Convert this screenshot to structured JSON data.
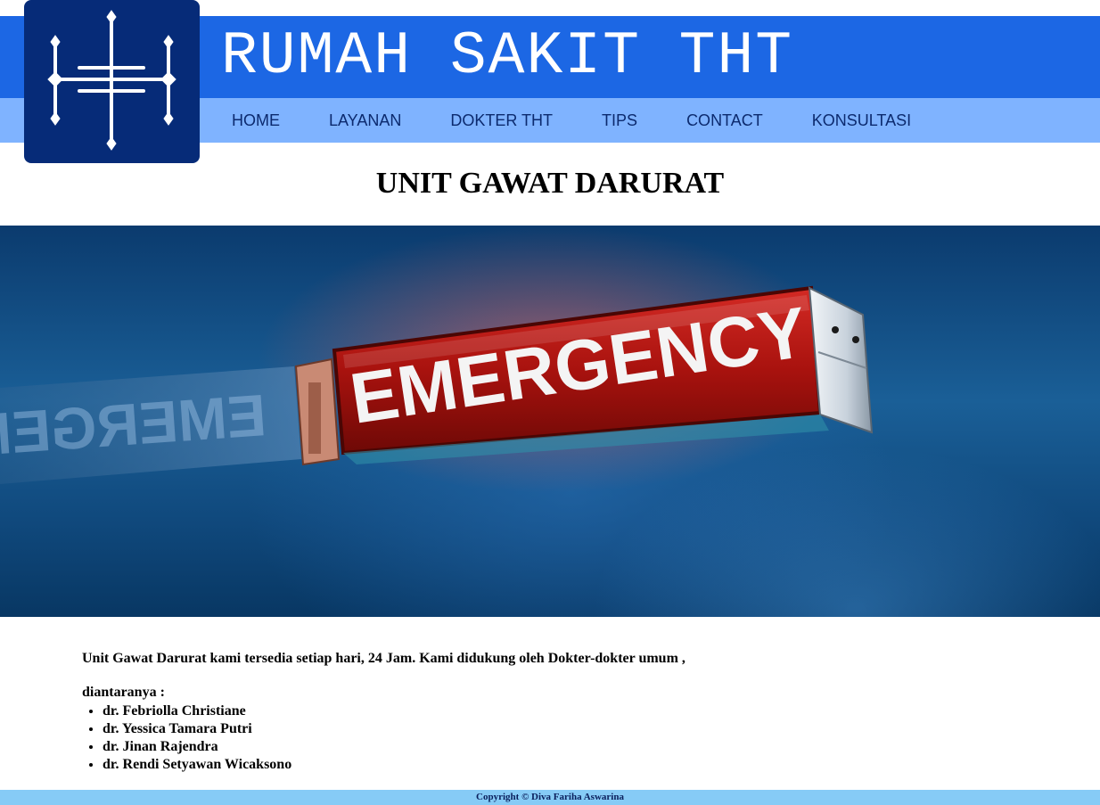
{
  "header": {
    "title": "RUMAH SAKIT THT",
    "nav": [
      "HOME",
      "LAYANAN",
      "DOKTER THT",
      "TIPS",
      "CONTACT",
      "KONSULTASI"
    ]
  },
  "main": {
    "heading": "UNIT GAWAT DARURAT",
    "banner": {
      "sign_text": "EMERGENCY",
      "reflection_text": "EMERGENCY"
    },
    "intro": "Unit Gawat Darurat kami tersedia setiap hari, 24 Jam. Kami didukung oleh Dokter-dokter umum ,",
    "list_label": "diantaranya :",
    "doctors": [
      "dr. Febriolla Christiane",
      "dr. Yessica Tamara Putri",
      "dr. Jinan Rajendra",
      "dr. Rendi Setyawan Wicaksono"
    ]
  },
  "footer": {
    "copyright": "Copyright © Diva Fariha Aswarina"
  },
  "colors": {
    "header_blue": "#1c67e4",
    "nav_bar": "#7fb3ff",
    "logo_bg": "#062b78",
    "footer_bar": "#86cbf6"
  },
  "icons": {
    "logo": "ht-monogram-logo"
  }
}
